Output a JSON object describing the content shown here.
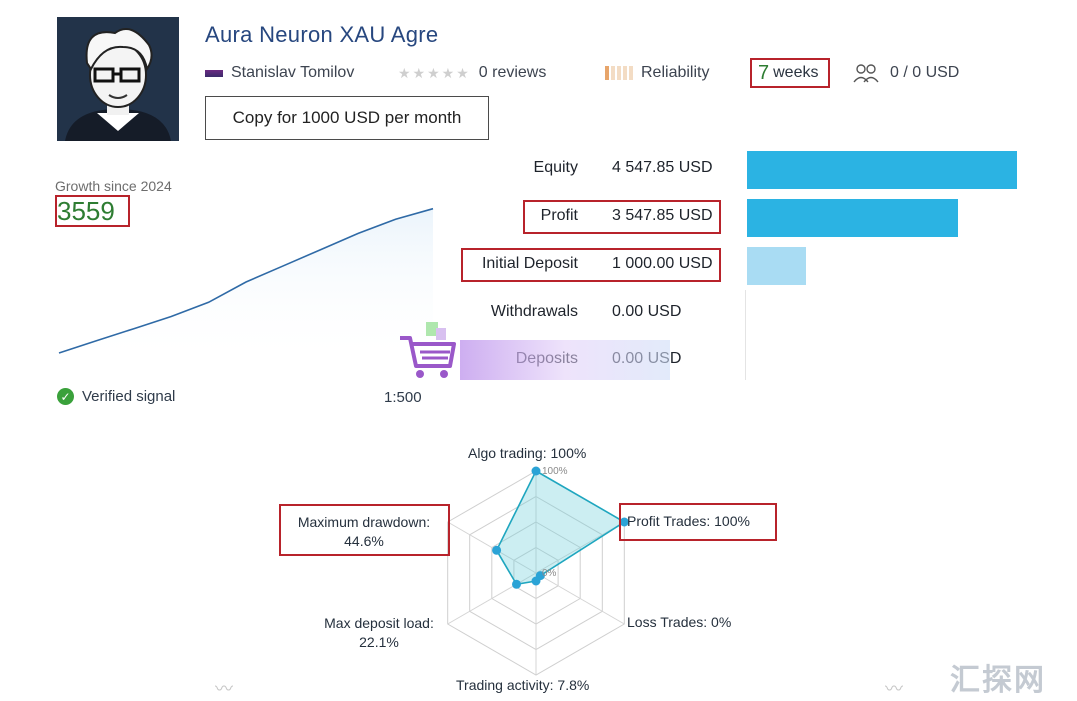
{
  "header": {
    "title": "Aura Neuron XAU Agre",
    "author": "Stanislav Tomilov",
    "reviews": "0 reviews",
    "reliability": "Reliability",
    "weeks_num": "7",
    "weeks_label": "weeks",
    "subscribers": "0 / 0 USD",
    "copy_button": "Copy for 1000 USD per month"
  },
  "growth": {
    "label": "Growth since 2024",
    "value": "3559"
  },
  "stats": [
    {
      "label": "Equity",
      "value": "4 547.85 USD",
      "highlight": false,
      "share": 1.0
    },
    {
      "label": "Profit",
      "value": "3 547.85 USD",
      "highlight": true,
      "share": 0.78
    },
    {
      "label": "Initial Deposit",
      "value": "1 000.00 USD",
      "highlight": true,
      "share": 0.22
    },
    {
      "label": "Withdrawals",
      "value": "0.00 USD",
      "highlight": false,
      "share": 0
    },
    {
      "label": "Deposits",
      "value": "0.00 USD",
      "highlight": false,
      "share": 0
    }
  ],
  "account": {
    "verified": "Verified signal",
    "leverage": "1:500"
  },
  "radar": {
    "axes": [
      {
        "label": "Algo trading: 100%",
        "value": 1.0,
        "highlight": false
      },
      {
        "label": "Profit Trades: 100%",
        "value": 1.0,
        "highlight": true
      },
      {
        "label": "Loss Trades: 0%",
        "value": 0.0,
        "highlight": false
      },
      {
        "label": "Trading activity: 7.8%",
        "value": 0.078,
        "highlight": false
      },
      {
        "label": "Max deposit load: 22.1%",
        "value": 0.221,
        "highlight": false
      },
      {
        "label": "Maximum drawdown: 44.6%",
        "value": 0.446,
        "highlight": true
      }
    ],
    "tick_top": "100%",
    "tick_center": "0%"
  },
  "watermark": "汇探网",
  "colors": {
    "accent_blue": "#2bb3e3",
    "highlight_red": "#b8232b",
    "positive_green": "#2e7d32",
    "title_blue": "#27477f"
  },
  "chart_data": {
    "type": "line",
    "title": "",
    "x": [
      0,
      1,
      2,
      3,
      4,
      5,
      6,
      7,
      8,
      9,
      10
    ],
    "y": [
      0,
      300,
      600,
      900,
      1250,
      1750,
      2150,
      2550,
      2950,
      3300,
      3559
    ],
    "ylim": [
      0,
      3600
    ],
    "grid": false
  }
}
